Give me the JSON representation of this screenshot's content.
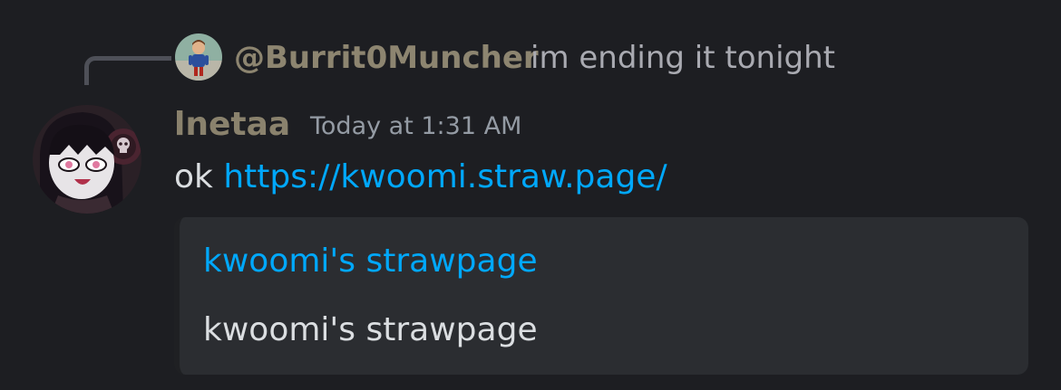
{
  "reply": {
    "author": "@Burrit0Muncher",
    "text": "im ending it tonight",
    "avatar_icon": "reply-author-avatar"
  },
  "message": {
    "author": "lnetaa",
    "timestamp": "Today at 1:31 AM",
    "prefix": "ok ",
    "link": "https://kwoomi.straw.page/",
    "avatar_icon": "message-author-avatar"
  },
  "embed": {
    "title": "kwoomi's strawpage",
    "description": "kwoomi's strawpage"
  },
  "colors": {
    "background": "#1d1e22",
    "embed_background": "#2b2d31",
    "link": "#00a8fc",
    "author": "#8a826d",
    "muted_text": "#949ba4",
    "body_text": "#dbdee1"
  }
}
